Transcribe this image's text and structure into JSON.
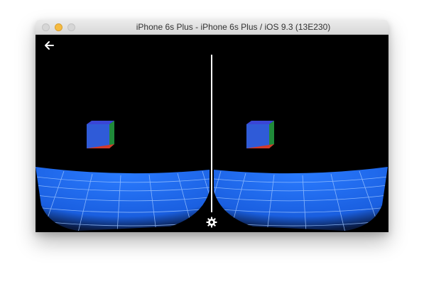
{
  "window": {
    "title": "iPhone 6s Plus - iPhone 6s Plus / iOS 9.3 (13E230)"
  },
  "toolbar": {
    "back_icon": "arrow-left-icon",
    "settings_icon": "gear-icon"
  },
  "scene": {
    "view_mode": "stereo-vr",
    "cube_colors": {
      "front": "#2f5bd8",
      "top": "#2f3fd0",
      "side": "#1f8a3a",
      "bottom": "#d23a2a"
    },
    "floor_color": "#1f6ff0",
    "grid_color": "#9cc4ff",
    "background": "#000000"
  }
}
